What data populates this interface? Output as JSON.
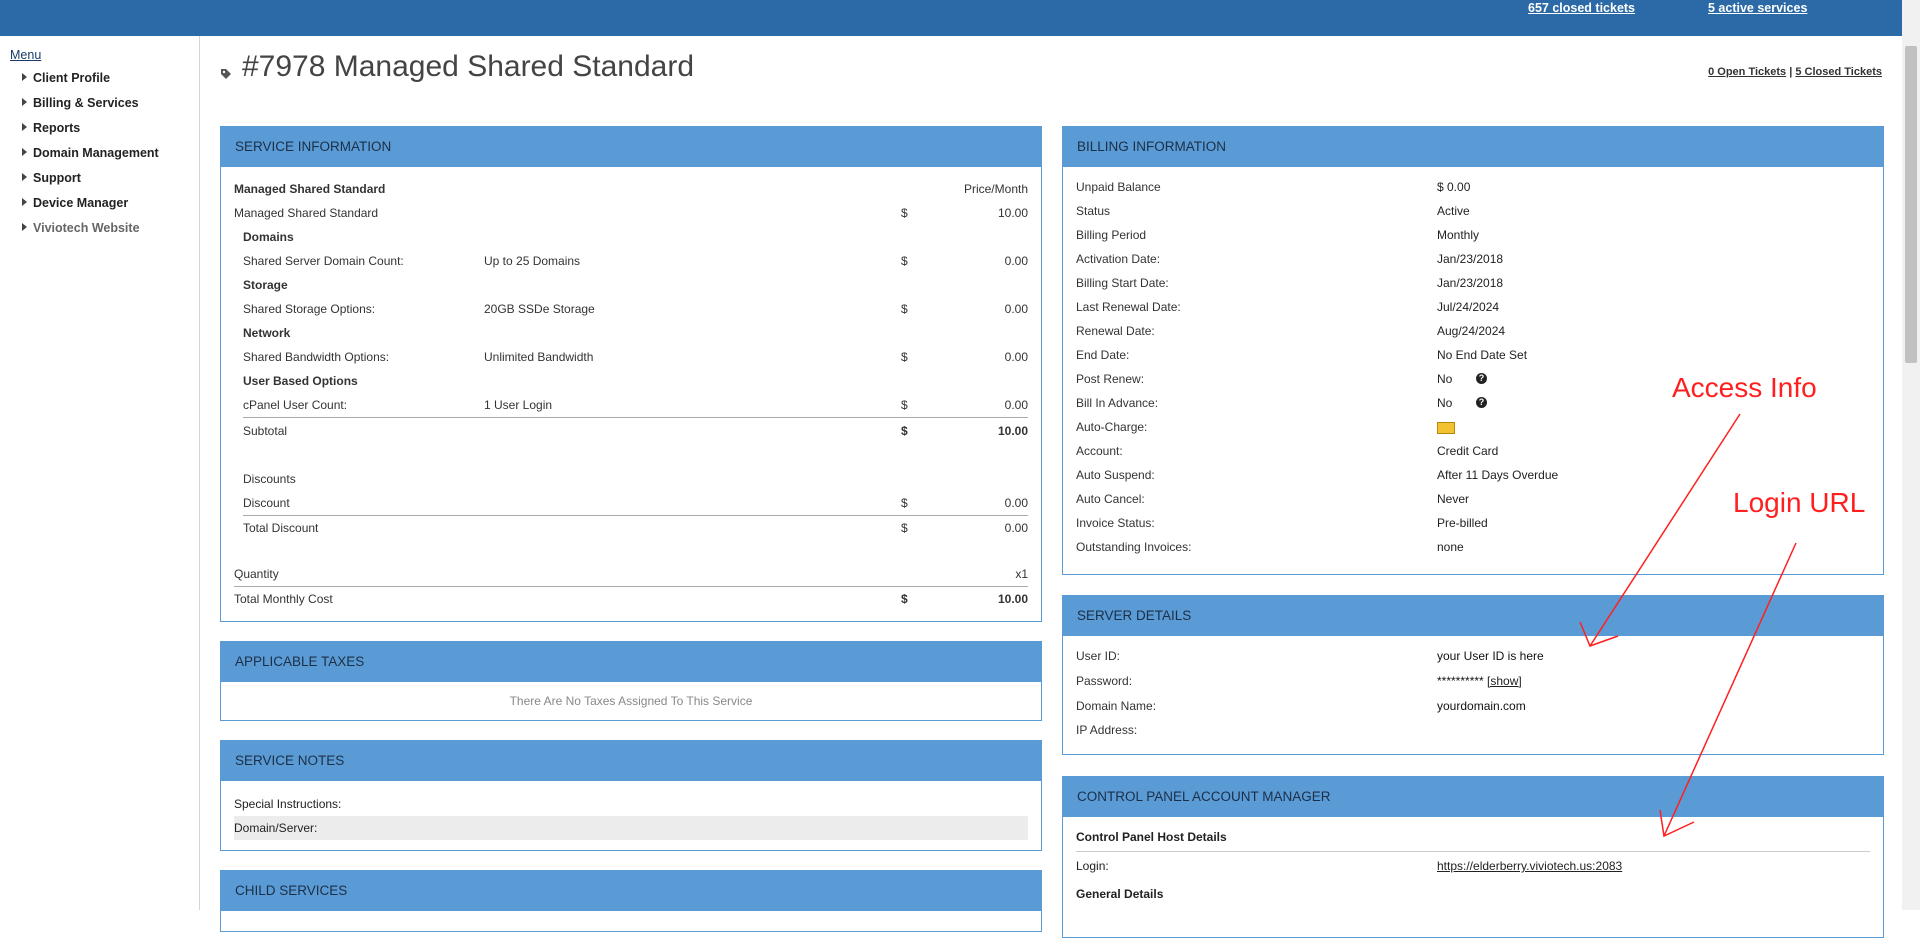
{
  "topbar": {
    "closed_tickets": "657 closed tickets",
    "active_services": "5 active services"
  },
  "sidebar": {
    "menu_title": "Menu",
    "items": [
      {
        "label": "Client Profile"
      },
      {
        "label": "Billing & Services"
      },
      {
        "label": "Reports"
      },
      {
        "label": "Domain Management"
      },
      {
        "label": "Support"
      },
      {
        "label": "Device Manager"
      },
      {
        "label": "Viviotech Website"
      }
    ]
  },
  "page": {
    "title": "#7978 Managed Shared Standard",
    "open_tickets": "0 Open Tickets",
    "separator": "|",
    "closed_tickets": "5 Closed Tickets"
  },
  "service_info": {
    "header": "SERVICE INFORMATION",
    "plan_name": "Managed Shared Standard",
    "price_col": "Price/Month",
    "plan_line": {
      "label": "Managed Shared Standard",
      "currency": "$",
      "amount": "10.00"
    },
    "groups": [
      {
        "title": "Domains",
        "label": "Shared Server Domain Count:",
        "value": "Up to 25 Domains",
        "currency": "$",
        "amount": "0.00"
      },
      {
        "title": "Storage",
        "label": "Shared Storage Options:",
        "value": "20GB SSDe Storage",
        "currency": "$",
        "amount": "0.00"
      },
      {
        "title": "Network",
        "label": "Shared Bandwidth Options:",
        "value": "Unlimited Bandwidth",
        "currency": "$",
        "amount": "0.00"
      },
      {
        "title": "User Based Options",
        "label": "cPanel User Count:",
        "value": "1 User Login",
        "currency": "$",
        "amount": "0.00"
      }
    ],
    "subtotal": {
      "label": "Subtotal",
      "currency": "$",
      "amount": "10.00"
    },
    "discounts_title": "Discounts",
    "discount": {
      "label": "Discount",
      "currency": "$",
      "amount": "0.00"
    },
    "total_discount": {
      "label": "Total Discount",
      "currency": "$",
      "amount": "0.00"
    },
    "quantity": {
      "label": "Quantity",
      "value": "x1"
    },
    "total": {
      "label": "Total Monthly Cost",
      "currency": "$",
      "amount": "10.00"
    }
  },
  "taxes": {
    "header": "APPLICABLE TAXES",
    "message": "There Are No Taxes Assigned To This Service"
  },
  "notes": {
    "header": "SERVICE NOTES",
    "special": "Special Instructions:",
    "domain_server": "Domain/Server:"
  },
  "child": {
    "header": "CHILD SERVICES"
  },
  "billing": {
    "header": "BILLING INFORMATION",
    "rows": [
      {
        "label": "Unpaid Balance",
        "value": "$ 0.00"
      },
      {
        "label": "Status",
        "value": "Active"
      },
      {
        "label": "Billing Period",
        "value": "Monthly"
      },
      {
        "label": "Activation Date:",
        "value": "Jan/23/2018"
      },
      {
        "label": "Billing Start Date:",
        "value": "Jan/23/2018"
      },
      {
        "label": "Last Renewal Date:",
        "value": "Jul/24/2024"
      },
      {
        "label": "Renewal Date:",
        "value": "Aug/24/2024"
      },
      {
        "label": "End Date:",
        "value": "No End Date Set"
      },
      {
        "label": "Post Renew:",
        "value": "No"
      },
      {
        "label": "Bill In Advance:",
        "value": "No"
      },
      {
        "label": "Auto-Charge:",
        "value": ""
      },
      {
        "label": "Account:",
        "value": "Credit Card"
      },
      {
        "label": "Auto Suspend:",
        "value": "After 11 Days Overdue"
      },
      {
        "label": "Auto Cancel:",
        "value": "Never"
      },
      {
        "label": "Invoice Status:",
        "value": "Pre-billed"
      },
      {
        "label": "Outstanding Invoices:",
        "value": "none"
      }
    ]
  },
  "server": {
    "header": "SERVER DETAILS",
    "user_id": {
      "label": "User ID:",
      "value": "your User ID is here"
    },
    "password": {
      "label": "Password:",
      "value": "**********",
      "show": "[show]"
    },
    "domain": {
      "label": "Domain Name:",
      "value": "yourdomain.com"
    },
    "ip": {
      "label": "IP Address:",
      "value": ""
    }
  },
  "cpanel": {
    "header": "CONTROL PANEL ACCOUNT MANAGER",
    "host_details": "Control Panel Host Details",
    "login": {
      "label": "Login:",
      "value": "https://elderberry.viviotech.us:2083"
    },
    "general": "General Details"
  },
  "annotations": {
    "access_info": "Access Info",
    "login_url": "Login URL",
    "color": "#ff1f1f"
  }
}
